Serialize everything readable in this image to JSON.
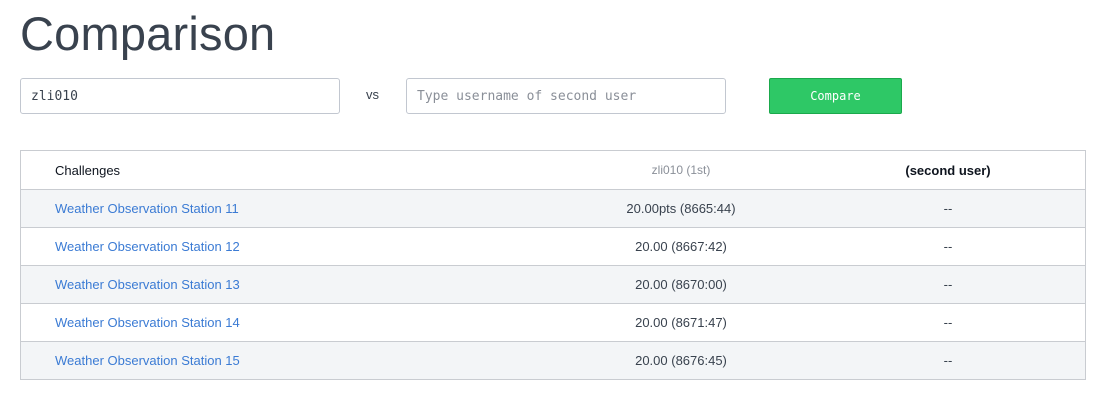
{
  "page": {
    "title": "Comparison"
  },
  "compare": {
    "first_user_value": "zli010",
    "vs_label": "vs",
    "second_user_placeholder": "Type username of second user",
    "second_user_value": "",
    "button_label": "Compare"
  },
  "table": {
    "headers": {
      "challenges": "Challenges",
      "first_user": "zli010 (1st)",
      "second_user": "(second user)"
    },
    "rows": [
      {
        "challenge": "Weather Observation Station 11",
        "first": "20.00pts (8665:44)",
        "second": "--"
      },
      {
        "challenge": "Weather Observation Station 12",
        "first": "20.00 (8667:42)",
        "second": "--"
      },
      {
        "challenge": "Weather Observation Station 13",
        "first": "20.00 (8670:00)",
        "second": "--"
      },
      {
        "challenge": "Weather Observation Station 14",
        "first": "20.00 (8671:47)",
        "second": "--"
      },
      {
        "challenge": "Weather Observation Station 15",
        "first": "20.00 (8676:45)",
        "second": "--"
      }
    ]
  },
  "colors": {
    "compare_button": "#2ec866",
    "link": "#3b7bd4",
    "row_stripe": "#f3f5f7"
  }
}
